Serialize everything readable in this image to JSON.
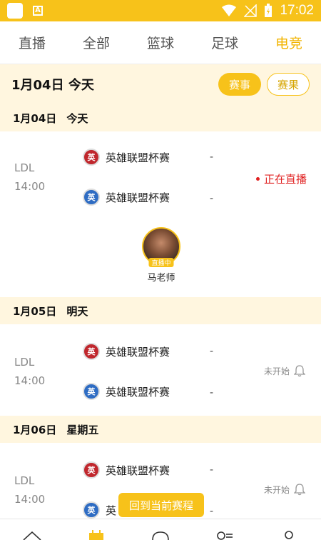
{
  "status_bar": {
    "time": "17:02",
    "sb_a": "A"
  },
  "tabs": [
    {
      "label": "直播"
    },
    {
      "label": "全部"
    },
    {
      "label": "篮球"
    },
    {
      "label": "足球"
    },
    {
      "label": "电竞"
    }
  ],
  "header": {
    "title": "1月04日 今天",
    "btn_events": "赛事",
    "btn_results": "赛果"
  },
  "sections": [
    {
      "date": "1月04日",
      "day": "今天",
      "league": "LDL",
      "time": "14:00",
      "team_a": "英雄联盟杯赛",
      "team_b": "英雄联盟杯赛",
      "logo_glyph": "英",
      "score_a": "-",
      "score_b": "-",
      "status": "正在直播",
      "anchor": {
        "tag": "直播中",
        "name": "马老师"
      }
    },
    {
      "date": "1月05日",
      "day": "明天",
      "league": "LDL",
      "time": "14:00",
      "team_a": "英雄联盟杯赛",
      "team_b": "英雄联盟杯赛",
      "logo_glyph": "英",
      "score_a": "-",
      "score_b": "-",
      "status": "未开始"
    },
    {
      "date": "1月06日",
      "day": "星期五",
      "league": "LDL",
      "time": "14:00",
      "team_a": "英雄联盟杯赛",
      "team_b": "英",
      "logo_glyph": "英",
      "score_a": "-",
      "score_b": "-",
      "status": "未开始"
    }
  ],
  "back_button": "回到当前赛程",
  "colors": {
    "accent": "#f7c21a",
    "live": "#e02020"
  }
}
